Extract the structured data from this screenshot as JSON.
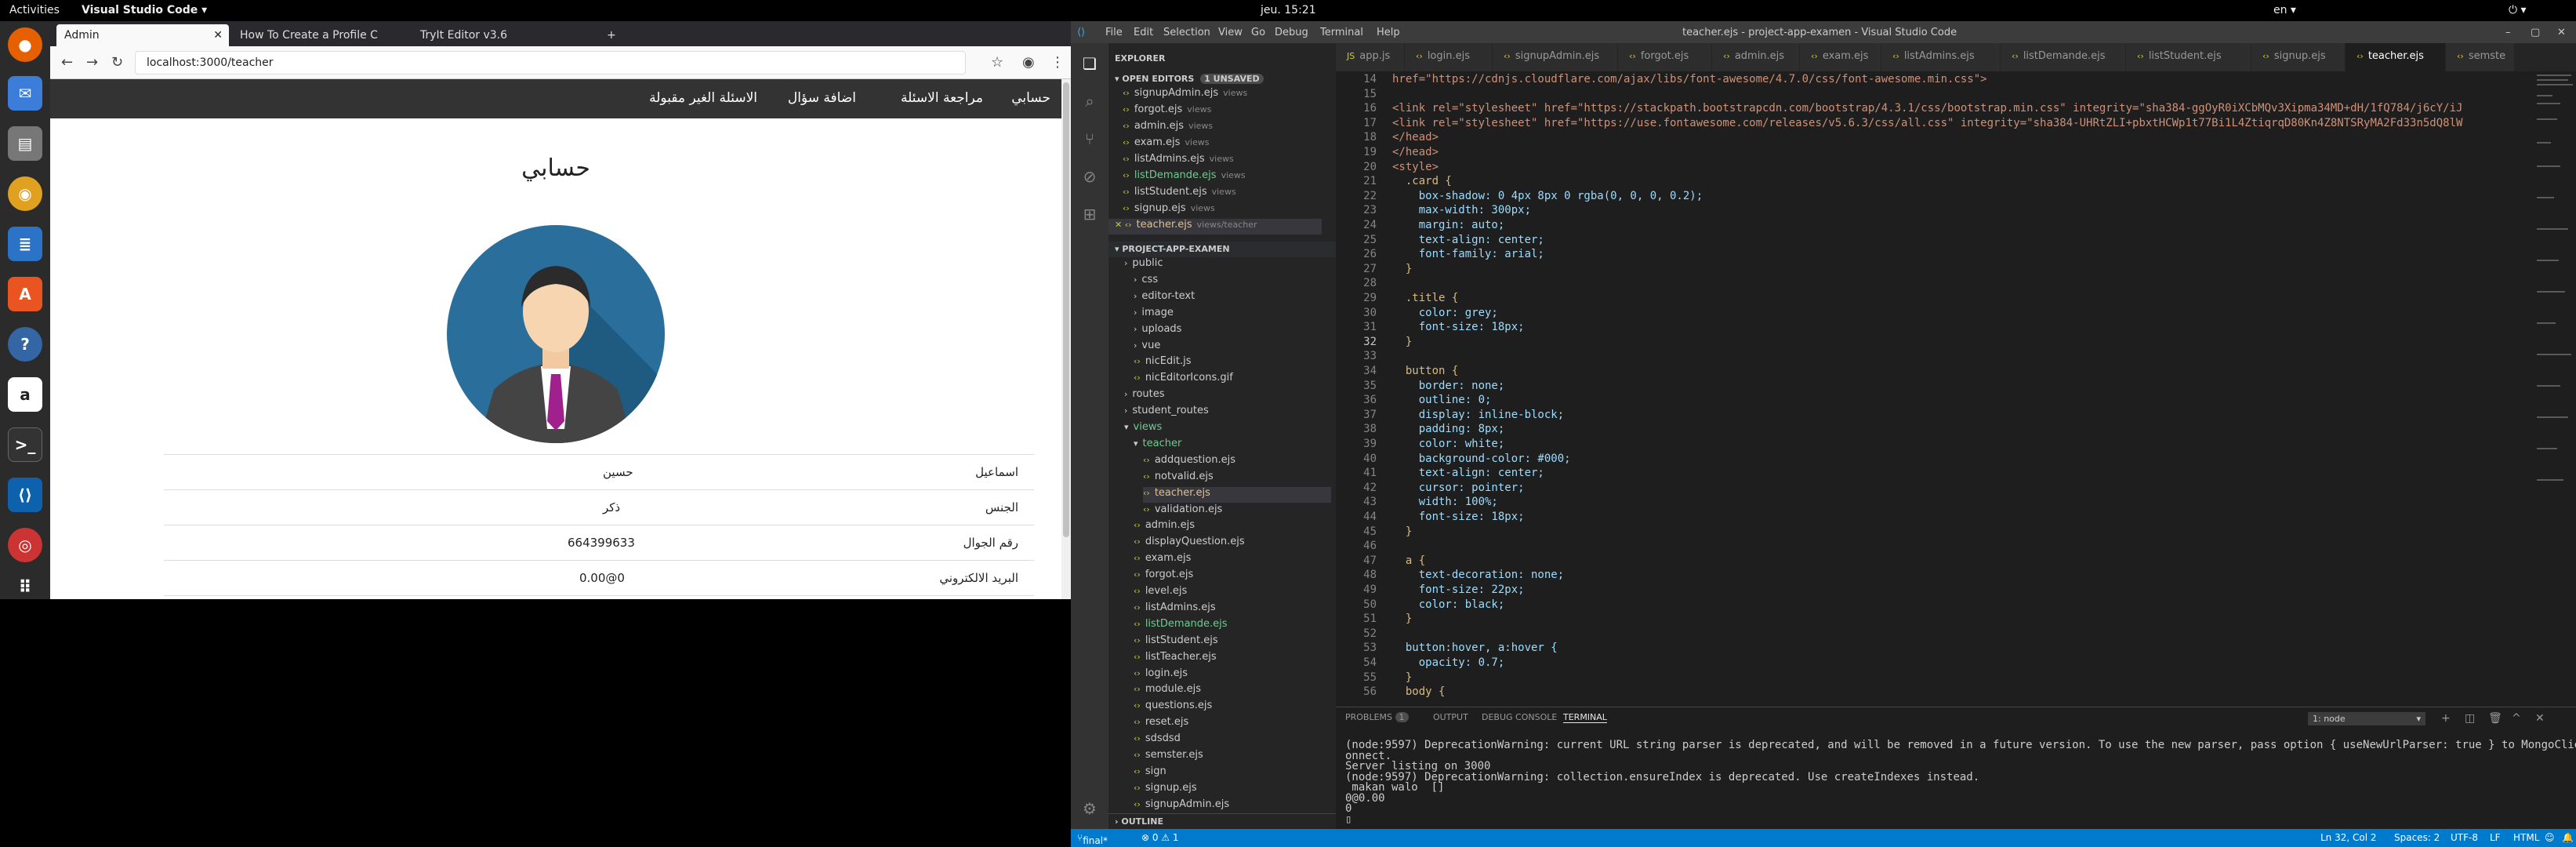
{
  "topbar": {
    "activities": "Activities",
    "app": "Visual Studio Code ▾",
    "clock": "jeu. 15:21",
    "lang": "en ▾"
  },
  "firefox": {
    "tabs": [
      "Admin",
      "How To Create a Profile C",
      "TryIt Editor v3.6"
    ],
    "url": "localhost:3000/teacher"
  },
  "site": {
    "nav": [
      "حسابي",
      "مراجعة الاسئلة",
      "اضافة سؤال",
      "الاسئلة الغير مقبولة"
    ],
    "title": "حسابي",
    "rows": [
      {
        "label": "اسماعيل",
        "value": "حسين"
      },
      {
        "label": "الجنس",
        "value": "ذكر"
      },
      {
        "label": "رقم الجوال",
        "value": "664399633"
      },
      {
        "label": "البريد الالكتروني",
        "value": "0@0.00"
      }
    ]
  },
  "vscode": {
    "title": "teacher.ejs - project-app-examen - Visual Studio Code",
    "menu": [
      "File",
      "Edit",
      "Selection",
      "View",
      "Go",
      "Debug",
      "Terminal",
      "Help"
    ],
    "explorer": {
      "header": "EXPLORER",
      "open_editors": "OPEN EDITORS",
      "unsaved": "1 UNSAVED",
      "open_files": [
        {
          "name": "signupAdmin.ejs",
          "sub": "views"
        },
        {
          "name": "forgot.ejs",
          "sub": "views"
        },
        {
          "name": "admin.ejs",
          "sub": "views"
        },
        {
          "name": "exam.ejs",
          "sub": "views"
        },
        {
          "name": "listAdmins.ejs",
          "sub": "views"
        },
        {
          "name": "listDemande.ejs",
          "sub": "views"
        },
        {
          "name": "listStudent.ejs",
          "sub": "views"
        },
        {
          "name": "signup.ejs",
          "sub": "views"
        },
        {
          "name": "teacher.ejs",
          "sub": "views/teacher"
        }
      ],
      "project": "PROJECT-APP-EXAMEN",
      "tree": [
        "public",
        "css",
        "editor-text",
        "image",
        "uploads",
        "vue",
        "nicEdit.js",
        "nicEditorIcons.gif",
        "routes",
        "student_routes",
        "views",
        "teacher",
        "addquestion.ejs",
        "notvalid.ejs",
        "teacher.ejs",
        "validation.ejs",
        "admin.ejs",
        "displayQuestion.ejs",
        "exam.ejs",
        "forgot.ejs",
        "level.ejs",
        "listAdmins.ejs",
        "listDemande.ejs",
        "listStudent.ejs",
        "listTeacher.ejs",
        "login.ejs",
        "module.ejs",
        "questions.ejs",
        "reset.ejs",
        "sdsdsd",
        "semster.ejs",
        "sign",
        "signup.ejs",
        "signupAdmin.ejs"
      ],
      "outline": "OUTLINE"
    },
    "editor_tabs": [
      "app.js",
      "login.ejs",
      "signupAdmin.ejs",
      "forgot.ejs",
      "admin.ejs",
      "exam.ejs",
      "listAdmins.ejs",
      "listDemande.ejs",
      "listStudent.ejs",
      "signup.ejs",
      "teacher.ejs",
      "semste"
    ],
    "code": [
      {
        "n": "14",
        "t": "href=\"https://cdnjs.cloudflare.com/ajax/libs/font-awesome/4.7.0/css/font-awesome.min.css\">"
      },
      {
        "n": "15",
        "t": ""
      },
      {
        "n": "16",
        "t": "<link rel=\"stylesheet\" href=\"https://stackpath.bootstrapcdn.com/bootstrap/4.3.1/css/bootstrap.min.css\" integrity=\"sha384-ggOyR0iXCbMQv3Xipma34MD+dH/1fQ784/j6cY/iJ"
      },
      {
        "n": "17",
        "t": "<link rel=\"stylesheet\" href=\"https://use.fontawesome.com/releases/v5.6.3/css/all.css\" integrity=\"sha384-UHRtZLI+pbxtHCWp1t77Bi1L4ZtiqrqD80Kn4Z8NTSRyMA2Fd33n5dQ8lW"
      },
      {
        "n": "18",
        "t": "</head>"
      },
      {
        "n": "19",
        "t": "</head>"
      },
      {
        "n": "20",
        "t": "<style>"
      },
      {
        "n": "21",
        "t": "  .card {"
      },
      {
        "n": "22",
        "t": "    box-shadow: 0 4px 8px 0 rgba(0, 0, 0, 0.2);"
      },
      {
        "n": "23",
        "t": "    max-width: 300px;"
      },
      {
        "n": "24",
        "t": "    margin: auto;"
      },
      {
        "n": "25",
        "t": "    text-align: center;"
      },
      {
        "n": "26",
        "t": "    font-family: arial;"
      },
      {
        "n": "27",
        "t": "  }"
      },
      {
        "n": "28",
        "t": ""
      },
      {
        "n": "29",
        "t": "  .title {"
      },
      {
        "n": "30",
        "t": "    color: grey;"
      },
      {
        "n": "31",
        "t": "    font-size: 18px;"
      },
      {
        "n": "32",
        "t": "  }"
      },
      {
        "n": "33",
        "t": ""
      },
      {
        "n": "34",
        "t": "  button {"
      },
      {
        "n": "35",
        "t": "    border: none;"
      },
      {
        "n": "36",
        "t": "    outline: 0;"
      },
      {
        "n": "37",
        "t": "    display: inline-block;"
      },
      {
        "n": "38",
        "t": "    padding: 8px;"
      },
      {
        "n": "39",
        "t": "    color: white;"
      },
      {
        "n": "40",
        "t": "    background-color: #000;"
      },
      {
        "n": "41",
        "t": "    text-align: center;"
      },
      {
        "n": "42",
        "t": "    cursor: pointer;"
      },
      {
        "n": "43",
        "t": "    width: 100%;"
      },
      {
        "n": "44",
        "t": "    font-size: 18px;"
      },
      {
        "n": "45",
        "t": "  }"
      },
      {
        "n": "46",
        "t": ""
      },
      {
        "n": "47",
        "t": "  a {"
      },
      {
        "n": "48",
        "t": "    text-decoration: none;"
      },
      {
        "n": "49",
        "t": "    font-size: 22px;"
      },
      {
        "n": "50",
        "t": "    color: black;"
      },
      {
        "n": "51",
        "t": "  }"
      },
      {
        "n": "52",
        "t": ""
      },
      {
        "n": "53",
        "t": "  button:hover, a:hover {"
      },
      {
        "n": "54",
        "t": "    opacity: 0.7;"
      },
      {
        "n": "55",
        "t": "  }"
      },
      {
        "n": "56",
        "t": "  body {"
      }
    ],
    "panel": {
      "tabs": [
        "PROBLEMS",
        "OUTPUT",
        "DEBUG CONSOLE",
        "TERMINAL"
      ],
      "problems_count": "1",
      "terminal_select": "1: node",
      "lines": [
        "(node:9597) DeprecationWarning: current URL string parser is deprecated, and will be removed in a future version. To use the new parser, pass option { useNewUrlParser: true } to MongoClient.c",
        "onnect.",
        "Server listing on 3000",
        "(node:9597) DeprecationWarning: collection.ensureIndex is deprecated. Use createIndexes instead.",
        " makan walo  []",
        "0@0.00",
        "0",
        "▯"
      ]
    },
    "status": {
      "branch": "final*",
      "errors": "⊗ 0 ⚠ 1",
      "position": "Ln 32, Col 2",
      "spaces": "Spaces: 2",
      "encoding": "UTF-8",
      "eol": "LF",
      "lang": "HTML"
    }
  },
  "colors": {
    "vscode_blue": "#007acc",
    "site_nav": "#333333",
    "avatar_bg": "#2a6f9b",
    "tie": "#a0208e"
  }
}
